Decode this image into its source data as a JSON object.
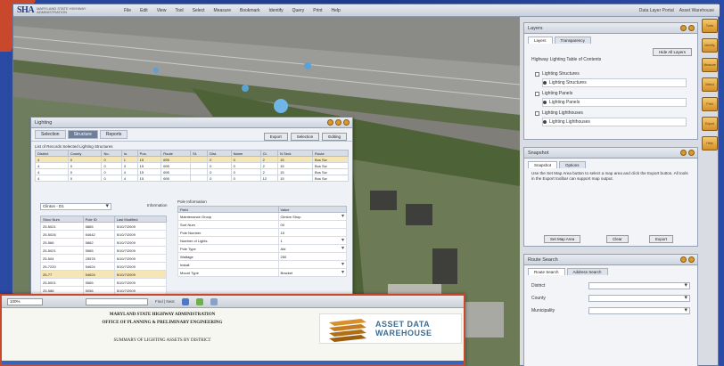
{
  "app": {
    "logo_mark": "SHA",
    "logo_sub": "MARYLAND STATE HIGHWAY ADMINISTRATION",
    "menu": [
      "File",
      "Edit",
      "View",
      "Tool",
      "Select",
      "Measure",
      "Bookmark",
      "Identify",
      "Query",
      "Print",
      "Help"
    ],
    "topbar_right": [
      "Data Layer Portal",
      "Asset Warehouse"
    ]
  },
  "layers_panel": {
    "title": "Layers",
    "tabs": [
      "Layers",
      "Transparency"
    ],
    "button": "Hide All Layers",
    "section_title": "Highway Lighting Table of Contents",
    "items": [
      {
        "label": "Lighting Structures",
        "checked": true
      },
      {
        "label": "Lighting Structures",
        "checked": false
      },
      {
        "label": "Lighting Panels",
        "checked": true
      },
      {
        "label": "Lighting Panels",
        "checked": false
      },
      {
        "label": "Lighting Lighthouses",
        "checked": true
      },
      {
        "label": "Lighting Lighthouses",
        "checked": false
      }
    ]
  },
  "snapshot_panel": {
    "title": "Snapshot",
    "tabs": [
      "Snapshot",
      "Options"
    ],
    "description": "Use the Set Map Area button to select a map area and click the Export button. All tools in the Export toolbar can support map output.",
    "buttons": [
      "Set Map Area",
      "Clear",
      "Export"
    ]
  },
  "route_panel": {
    "title": "Route Search",
    "tabs": [
      "Route Search",
      "Address Search"
    ],
    "fields": [
      "District",
      "County",
      "Municipality"
    ]
  },
  "toolbar_buttons": [
    "Tools",
    "Identify",
    "Measure",
    "Select",
    "Print",
    "Export",
    "Help"
  ],
  "lighting": {
    "title": "Lighting",
    "tabs": [
      "Selection",
      "Structure",
      "Reports"
    ],
    "active_tab": "Structure",
    "actions": [
      "Export",
      "Selection",
      "Editing"
    ],
    "sublabel": "List of Records Selected Lighting Structures",
    "columns": [
      "District",
      "County",
      "No.",
      "In.",
      "Pos.",
      "Route",
      "St.",
      "Dist.",
      "Name",
      "Ct.",
      "N Sect.",
      "Route"
    ],
    "rows": [
      {
        "cells": [
          "4",
          "0",
          "0",
          "1",
          "15",
          "695",
          "",
          "0",
          "0",
          "2",
          "15",
          "Bus Sw"
        ],
        "selected": true
      },
      {
        "cells": [
          "4",
          "0",
          "0",
          "3",
          "15",
          "695",
          "",
          "0",
          "0",
          "2",
          "15",
          "Bus Sw"
        ],
        "selected": false
      },
      {
        "cells": [
          "4",
          "0",
          "0",
          "4",
          "15",
          "695",
          "",
          "0",
          "0",
          "2",
          "15",
          "Bus Sw"
        ],
        "selected": false
      },
      {
        "cells": [
          "4",
          "0",
          "0",
          "4",
          "15",
          "695",
          "",
          "0",
          "0",
          "12",
          "15",
          "Bus Sw"
        ],
        "selected": false
      }
    ],
    "district_select": "Clinton - D1",
    "info_link": "Information",
    "id_columns": [
      "Struc Num",
      "Pole ID",
      "Last Modified"
    ],
    "id_rows": [
      {
        "cells": [
          "25-5021",
          "5865",
          "5/10/7/2009"
        ],
        "selected": false
      },
      {
        "cells": [
          "25-5026",
          "54642",
          "5/10/7/2009"
        ],
        "selected": false
      },
      {
        "cells": [
          "25-566",
          "5862",
          "5/10/7/2009"
        ],
        "selected": false
      },
      {
        "cells": [
          "25-5021",
          "5565",
          "5/10/7/2009"
        ],
        "selected": false
      },
      {
        "cells": [
          "25-504",
          "25578",
          "5/10/7/2009"
        ],
        "selected": false
      },
      {
        "cells": [
          "25-7220",
          "54624",
          "5/10/7/2009"
        ],
        "selected": false
      },
      {
        "cells": [
          "25-77",
          "54624",
          "5/10/7/2009"
        ],
        "selected": true
      },
      {
        "cells": [
          "25-5001",
          "5565",
          "5/10/7/2009"
        ],
        "selected": false
      },
      {
        "cells": [
          "25-588",
          "5056",
          "5/10/7/2009"
        ],
        "selected": false
      }
    ],
    "attr_title": "Pole Information",
    "attr_columns": [
      "Field",
      "Value"
    ],
    "attrs": [
      {
        "field": "Maintenance Group",
        "value": "Clinton Shop",
        "dropdown": true
      },
      {
        "field": "Sort Num",
        "value": "00",
        "dropdown": false
      },
      {
        "field": "Pole Number",
        "value": "15",
        "dropdown": false
      },
      {
        "field": "Number of Lights",
        "value": "1",
        "dropdown": true
      },
      {
        "field": "Pole Type",
        "value": "Ald",
        "dropdown": true
      },
      {
        "field": "Wattage",
        "value": "250",
        "dropdown": false
      },
      {
        "field": "Install",
        "value": "",
        "dropdown": true
      },
      {
        "field": "Mount Type",
        "value": "Bracket",
        "dropdown": true
      }
    ]
  },
  "report": {
    "zoom": "100%",
    "find_label": "Find | Next",
    "line1": "MARYLAND STATE HIGHWAY ADMINISTRATION",
    "line2": "OFFICE OF PLANNING & PRELIMINARY ENGINEERING",
    "line3": "SUMMARY OF LIGHTING ASSETS BY DISTRICT",
    "logo_line1": "ASSET DATA",
    "logo_line2": "WAREHOUSE"
  },
  "colors": {
    "accent_orange": "#d89a2a",
    "report_border": "#c9472a",
    "backdrop_blue": "#1f3f8e",
    "selected_row": "#f6e6b6"
  }
}
